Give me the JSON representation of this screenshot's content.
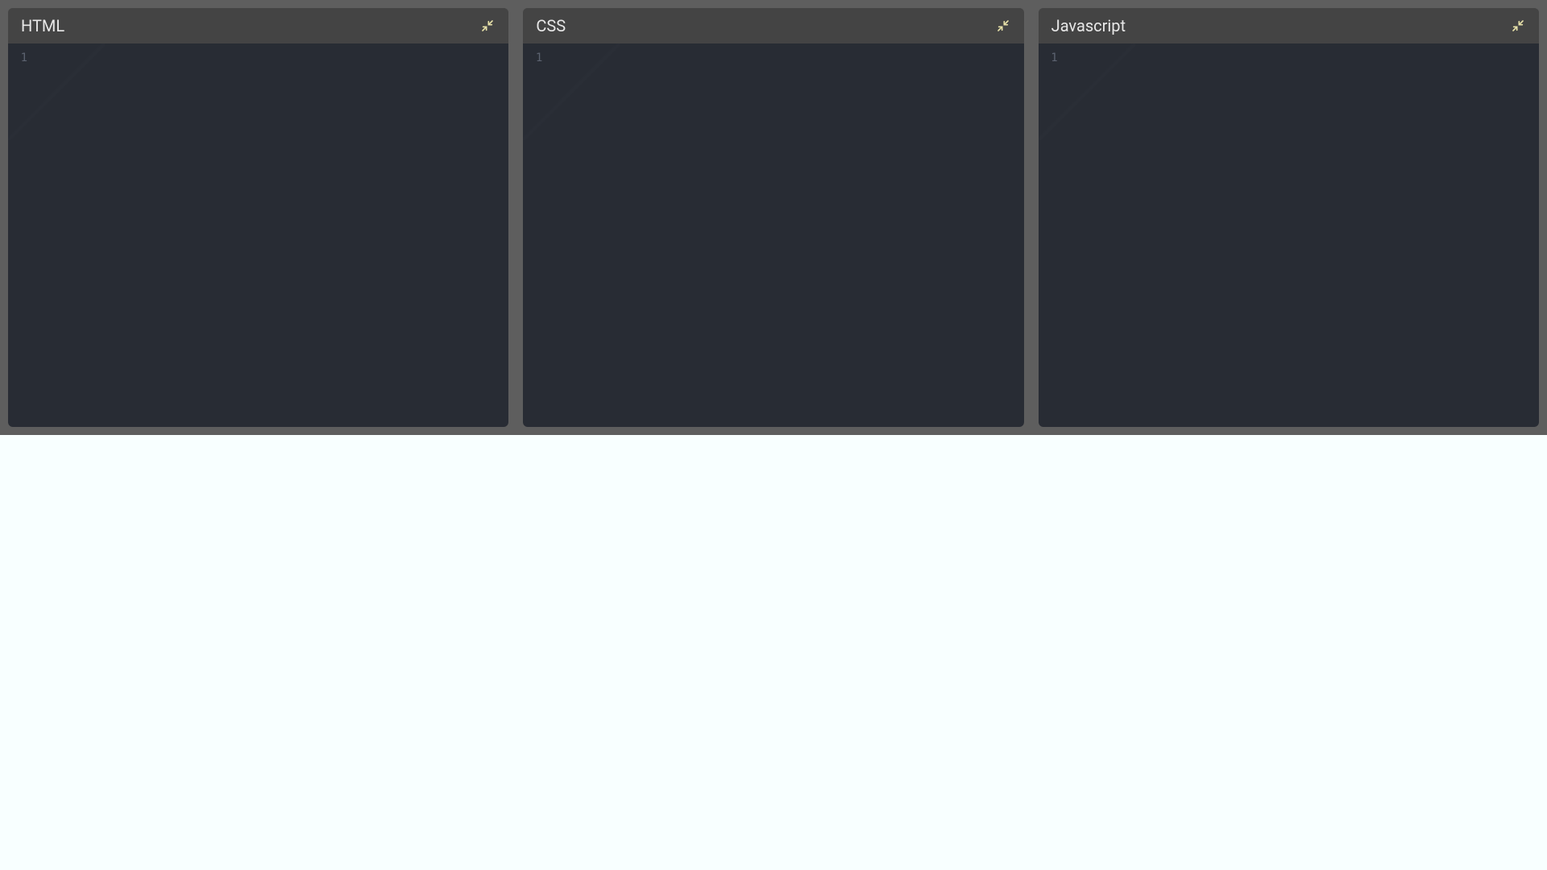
{
  "panels": [
    {
      "title": "HTML",
      "line_number": "1",
      "collapse_icon": "collapse-icon"
    },
    {
      "title": "CSS",
      "line_number": "1",
      "collapse_icon": "collapse-icon"
    },
    {
      "title": "Javascript",
      "line_number": "1",
      "collapse_icon": "collapse-icon"
    }
  ]
}
